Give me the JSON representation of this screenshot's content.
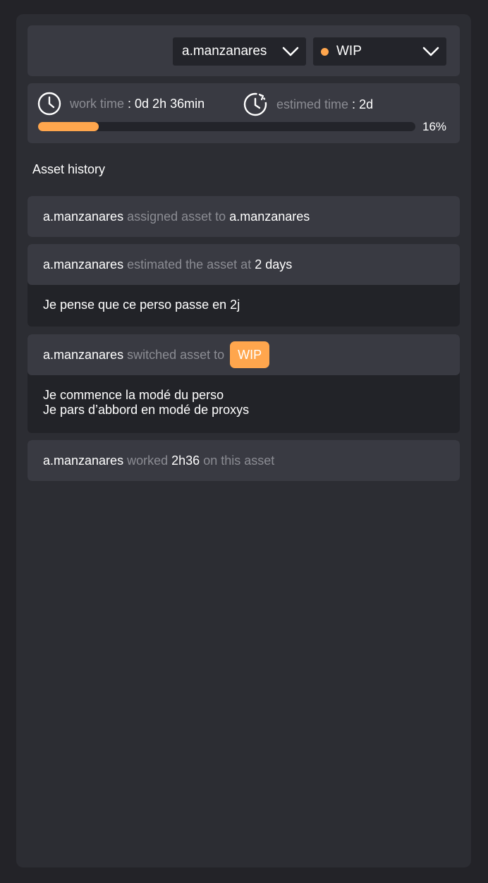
{
  "header": {
    "assignee": "a.manzanares",
    "status": "WIP",
    "status_color": "#ffa64d"
  },
  "time": {
    "work_label": "work time",
    "work_value": "0d 2h 36min",
    "estimate_label": "estimed time",
    "estimate_value": "2d",
    "progress": 0.16,
    "progress_text": "16%"
  },
  "history": {
    "title": "Asset history",
    "items": [
      {
        "user": "a.manzanares",
        "action": "assigned asset to",
        "target": "a.manzanares"
      },
      {
        "user": "a.manzanares",
        "action": "estimated the asset at",
        "target": "2 days",
        "comment": "Je pense que ce perso passe en 2j"
      },
      {
        "user": "a.manzanares",
        "action": "switched asset to",
        "badge": "WIP",
        "comment_lines": [
          "Je commence la modé du perso",
          "Je pars d’abbord en modé de proxys"
        ]
      },
      {
        "user": "a.manzanares",
        "action": "worked",
        "target": "2h36",
        "suffix": "on this asset"
      }
    ]
  },
  "icons": [
    "clock-icon",
    "estimate-clock-icon",
    "chevron-down-icon"
  ],
  "colors": {
    "accent": "#ffa64d",
    "panel": "#2c2d33",
    "card": "#393a42"
  }
}
